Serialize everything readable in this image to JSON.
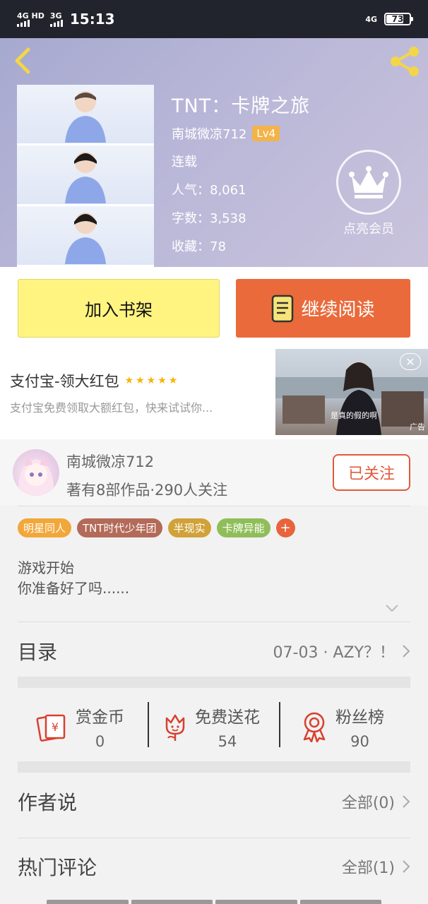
{
  "status_bar": {
    "network1": "4G HD",
    "network2": "3G",
    "time": "15:13",
    "network_right": "4G",
    "battery": "73"
  },
  "book": {
    "title": "TNT：卡牌之旅",
    "author": "南城微凉712",
    "level": "Lv4",
    "status": "连载",
    "popularity": "人气：8,061",
    "word_count": "字数：3,538",
    "favorites": "收藏：78",
    "vip_label": "点亮会员"
  },
  "actions": {
    "add_shelf": "加入书架",
    "continue_read": "继续阅读"
  },
  "ad": {
    "title": "支付宝-领大红包",
    "stars": "★★★★★",
    "desc": "支付宝免费领取大额红包，快来试试你...",
    "caption": "是真的假的啊",
    "tag": "广告",
    "close": "✕"
  },
  "author": {
    "name": "南城微凉712",
    "stats": "著有8部作品·290人关注",
    "follow": "已关注"
  },
  "tags": [
    {
      "label": "明星同人",
      "color": "#f2a73a"
    },
    {
      "label": "TNT时代少年团",
      "color": "#b36a58"
    },
    {
      "label": "半现实",
      "color": "#d1a23a"
    },
    {
      "label": "卡牌异能",
      "color": "#8fbe58"
    }
  ],
  "tag_more": "+",
  "intro": {
    "line1": "游戏开始",
    "line2": "你准备好了吗......"
  },
  "catalog": {
    "title": "目录",
    "latest": "07-03 · AZY？！"
  },
  "stats": [
    {
      "label": "赏金币",
      "value": "0",
      "icon": "red-envelope-icon"
    },
    {
      "label": "免费送花",
      "value": "54",
      "icon": "flower-icon"
    },
    {
      "label": "粉丝榜",
      "value": "90",
      "icon": "medal-icon"
    }
  ],
  "author_says": {
    "title": "作者说",
    "more": "全部(0)"
  },
  "hot_comments": {
    "title": "热门评论",
    "more": "全部(1)"
  },
  "colors": {
    "accent": "#ea6a3b",
    "shelf_button": "#fff480",
    "follow_border": "#e25a3b",
    "icon_red": "#d8402e"
  }
}
